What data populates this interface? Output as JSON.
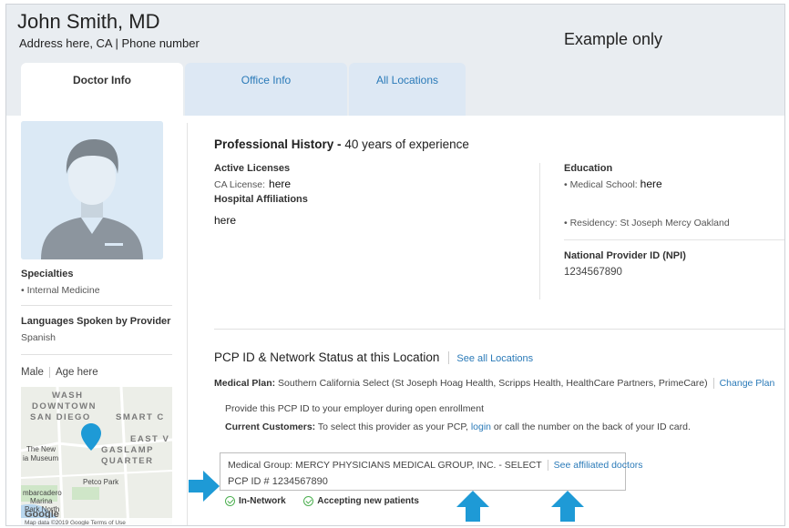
{
  "header": {
    "name": "John Smith, MD",
    "address": "Address here, CA  | Phone number",
    "example": "Example only"
  },
  "tabs": [
    {
      "label": "Doctor Info",
      "active": true
    },
    {
      "label": "Office Info",
      "active": false
    },
    {
      "label": "All Locations",
      "active": false
    }
  ],
  "sidebar": {
    "specialties_label": "Specialties",
    "specialty": "• Internal Medicine",
    "languages_label": "Languages Spoken by Provider",
    "language": "Spanish",
    "gender": "Male",
    "age": "Age here",
    "map": {
      "labels": [
        "WASH",
        "DOWNTOWN",
        "SAN DIEGO",
        "SMART C",
        "EAST V",
        "GASLAMP",
        "QUARTER",
        "The New",
        "ia Museum",
        "Petco Park",
        "mbarcadero",
        "Marina",
        "Park North"
      ],
      "footer": "Map data ©2019 Google   Terms of Use",
      "google": "Google"
    }
  },
  "professional": {
    "title": "Professional History -",
    "experience": "40 years of experience",
    "active_licenses_label": "Active Licenses",
    "ca_license_label": "CA License:",
    "ca_license_value": "here",
    "hospital_label": "Hospital Affiliations",
    "hospital_value": "here",
    "education_label": "Education",
    "medical_school_label": "• Medical School:",
    "medical_school_value": "here",
    "residency": "• Residency: St Joseph Mercy Oakland",
    "npi_label": "National Provider ID (NPI)",
    "npi_value": "1234567890"
  },
  "pcp": {
    "title": "PCP ID & Network Status at this Location",
    "see_all": "See all Locations",
    "plan_label": "Medical Plan:",
    "plan_value": "Southern California Select (St Joseph Hoag Health, Scripps Health, HealthCare Partners, PrimeCare)",
    "change_plan": "Change Plan",
    "provide_text": "Provide this PCP ID to your employer during open enrollment",
    "current_label": "Current Customers:",
    "current_text_1": "To select this provider as your PCP,",
    "login": "login",
    "current_text_2": "or call the number on the back of your ID card.",
    "medical_group": "Medical Group: MERCY PHYSICIANS MEDICAL GROUP, INC. - SELECT",
    "see_affiliated": "See affiliated doctors",
    "pcp_id": "PCP ID # 1234567890",
    "in_network": "In-Network",
    "accepting": "Accepting new patients"
  },
  "colors": {
    "link": "#2a7ab8",
    "arrow": "#1e9ad6",
    "check": "#4caf50",
    "map_pin": "#1e9ad6"
  }
}
